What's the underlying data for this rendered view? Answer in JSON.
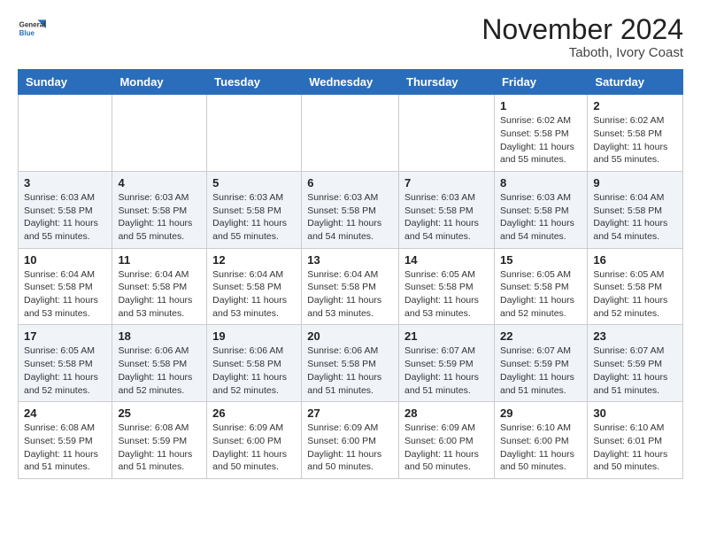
{
  "header": {
    "logo": {
      "general": "General",
      "blue": "Blue"
    },
    "month": "November 2024",
    "location": "Taboth, Ivory Coast"
  },
  "calendar": {
    "weekdays": [
      "Sunday",
      "Monday",
      "Tuesday",
      "Wednesday",
      "Thursday",
      "Friday",
      "Saturday"
    ],
    "weeks": [
      [
        {
          "day": null
        },
        {
          "day": null
        },
        {
          "day": null
        },
        {
          "day": null
        },
        {
          "day": null
        },
        {
          "day": 1,
          "sunrise": "6:02 AM",
          "sunset": "5:58 PM",
          "daylight": "11 hours and 55 minutes."
        },
        {
          "day": 2,
          "sunrise": "6:02 AM",
          "sunset": "5:58 PM",
          "daylight": "11 hours and 55 minutes."
        }
      ],
      [
        {
          "day": 3,
          "sunrise": "6:03 AM",
          "sunset": "5:58 PM",
          "daylight": "11 hours and 55 minutes."
        },
        {
          "day": 4,
          "sunrise": "6:03 AM",
          "sunset": "5:58 PM",
          "daylight": "11 hours and 55 minutes."
        },
        {
          "day": 5,
          "sunrise": "6:03 AM",
          "sunset": "5:58 PM",
          "daylight": "11 hours and 55 minutes."
        },
        {
          "day": 6,
          "sunrise": "6:03 AM",
          "sunset": "5:58 PM",
          "daylight": "11 hours and 54 minutes."
        },
        {
          "day": 7,
          "sunrise": "6:03 AM",
          "sunset": "5:58 PM",
          "daylight": "11 hours and 54 minutes."
        },
        {
          "day": 8,
          "sunrise": "6:03 AM",
          "sunset": "5:58 PM",
          "daylight": "11 hours and 54 minutes."
        },
        {
          "day": 9,
          "sunrise": "6:04 AM",
          "sunset": "5:58 PM",
          "daylight": "11 hours and 54 minutes."
        }
      ],
      [
        {
          "day": 10,
          "sunrise": "6:04 AM",
          "sunset": "5:58 PM",
          "daylight": "11 hours and 53 minutes."
        },
        {
          "day": 11,
          "sunrise": "6:04 AM",
          "sunset": "5:58 PM",
          "daylight": "11 hours and 53 minutes."
        },
        {
          "day": 12,
          "sunrise": "6:04 AM",
          "sunset": "5:58 PM",
          "daylight": "11 hours and 53 minutes."
        },
        {
          "day": 13,
          "sunrise": "6:04 AM",
          "sunset": "5:58 PM",
          "daylight": "11 hours and 53 minutes."
        },
        {
          "day": 14,
          "sunrise": "6:05 AM",
          "sunset": "5:58 PM",
          "daylight": "11 hours and 53 minutes."
        },
        {
          "day": 15,
          "sunrise": "6:05 AM",
          "sunset": "5:58 PM",
          "daylight": "11 hours and 52 minutes."
        },
        {
          "day": 16,
          "sunrise": "6:05 AM",
          "sunset": "5:58 PM",
          "daylight": "11 hours and 52 minutes."
        }
      ],
      [
        {
          "day": 17,
          "sunrise": "6:05 AM",
          "sunset": "5:58 PM",
          "daylight": "11 hours and 52 minutes."
        },
        {
          "day": 18,
          "sunrise": "6:06 AM",
          "sunset": "5:58 PM",
          "daylight": "11 hours and 52 minutes."
        },
        {
          "day": 19,
          "sunrise": "6:06 AM",
          "sunset": "5:58 PM",
          "daylight": "11 hours and 52 minutes."
        },
        {
          "day": 20,
          "sunrise": "6:06 AM",
          "sunset": "5:58 PM",
          "daylight": "11 hours and 51 minutes."
        },
        {
          "day": 21,
          "sunrise": "6:07 AM",
          "sunset": "5:59 PM",
          "daylight": "11 hours and 51 minutes."
        },
        {
          "day": 22,
          "sunrise": "6:07 AM",
          "sunset": "5:59 PM",
          "daylight": "11 hours and 51 minutes."
        },
        {
          "day": 23,
          "sunrise": "6:07 AM",
          "sunset": "5:59 PM",
          "daylight": "11 hours and 51 minutes."
        }
      ],
      [
        {
          "day": 24,
          "sunrise": "6:08 AM",
          "sunset": "5:59 PM",
          "daylight": "11 hours and 51 minutes."
        },
        {
          "day": 25,
          "sunrise": "6:08 AM",
          "sunset": "5:59 PM",
          "daylight": "11 hours and 51 minutes."
        },
        {
          "day": 26,
          "sunrise": "6:09 AM",
          "sunset": "6:00 PM",
          "daylight": "11 hours and 50 minutes."
        },
        {
          "day": 27,
          "sunrise": "6:09 AM",
          "sunset": "6:00 PM",
          "daylight": "11 hours and 50 minutes."
        },
        {
          "day": 28,
          "sunrise": "6:09 AM",
          "sunset": "6:00 PM",
          "daylight": "11 hours and 50 minutes."
        },
        {
          "day": 29,
          "sunrise": "6:10 AM",
          "sunset": "6:00 PM",
          "daylight": "11 hours and 50 minutes."
        },
        {
          "day": 30,
          "sunrise": "6:10 AM",
          "sunset": "6:01 PM",
          "daylight": "11 hours and 50 minutes."
        }
      ]
    ]
  },
  "labels": {
    "sunrise_prefix": "Sunrise: ",
    "sunset_prefix": "Sunset: ",
    "daylight_prefix": "Daylight: "
  }
}
